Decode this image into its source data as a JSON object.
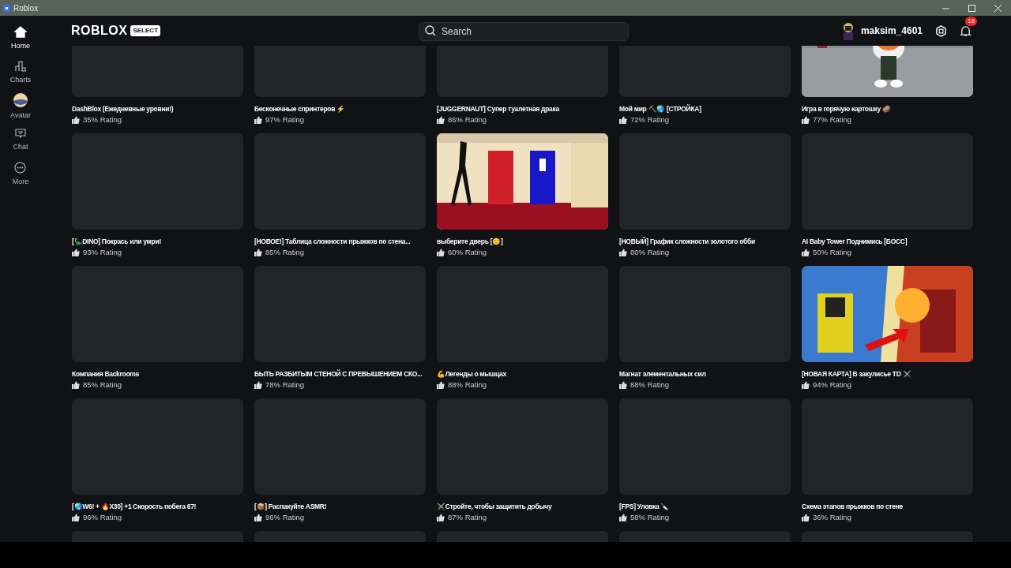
{
  "window": {
    "title": "Roblox"
  },
  "sidebar": {
    "items": [
      {
        "label": "Home",
        "selected": true
      },
      {
        "label": "Charts",
        "selected": false
      },
      {
        "label": "Avatar",
        "selected": false
      },
      {
        "label": "Chat",
        "selected": false
      },
      {
        "label": "More",
        "selected": false
      }
    ]
  },
  "header": {
    "logo": "ROBLOX",
    "logo_badge": "SELECT",
    "search": {
      "placeholder": "Search"
    },
    "username": "maksim_4601",
    "notification_count": "18"
  },
  "games": [
    {
      "title": "DashBlox (Ежедневные уровни!)",
      "rating": "35% Rating",
      "kind": "blank"
    },
    {
      "title": "Бесконечные спринтеров ⚡",
      "rating": "97% Rating",
      "kind": "blank"
    },
    {
      "title": "[JUGGERNAUT] Супер туалетная драка",
      "rating": "86% Rating",
      "kind": "blank"
    },
    {
      "title": "Мой мир ⛏️🌏 [СТРОЙКА]",
      "rating": "72% Rating",
      "kind": "blank"
    },
    {
      "title": "Игра в горячую картошку 🥔",
      "rating": "77% Rating",
      "kind": "picture"
    },
    {
      "title": "[🦕DINO] Покрась или умри!",
      "rating": "93% Rating",
      "kind": "blank"
    },
    {
      "title": "[НОВОЕ!] Таблица сложности прыжков по стена...",
      "rating": "85% Rating",
      "kind": "blank"
    },
    {
      "title": "выберите дверь [🙂]",
      "rating": "60% Rating",
      "kind": "picture"
    },
    {
      "title": "[НОВЫЙ] График сложности золотого обби",
      "rating": "80% Rating",
      "kind": "blank"
    },
    {
      "title": "AI Baby Tower Поднимись [БОСС]",
      "rating": "50% Rating",
      "kind": "blank"
    },
    {
      "title": "Компания Backrooms",
      "rating": "85% Rating",
      "kind": "blank"
    },
    {
      "title": "БЫТЬ РАЗБИТЫМ СТЕНОЙ С ПРЕВЫШЕНИЕМ СКО...",
      "rating": "78% Rating",
      "kind": "blank"
    },
    {
      "title": "💪Легенды о мышцах",
      "rating": "88% Rating",
      "kind": "blank"
    },
    {
      "title": "Магнат элементальных сил",
      "rating": "88% Rating",
      "kind": "blank"
    },
    {
      "title": "[НОВАЯ КАРТА] В закулисье TD ⚔️",
      "rating": "94% Rating",
      "kind": "picture"
    },
    {
      "title": "[🌏W6! + 🔥X30] +1 Скорость побега 67!",
      "rating": "96% Rating",
      "kind": "blank"
    },
    {
      "title": "[📦] Распакуйте ASMR!",
      "rating": "96% Rating",
      "kind": "blank"
    },
    {
      "title": "⚔️Стройте, чтобы защитить добычу",
      "rating": "87% Rating",
      "kind": "blank"
    },
    {
      "title": "[FPS] Уловка 🔪",
      "rating": "58% Rating",
      "kind": "blank"
    },
    {
      "title": "Схема этапов прыжков по стене",
      "rating": "36% Rating",
      "kind": "blank"
    },
    {
      "kind": "blank"
    },
    {
      "kind": "blank"
    },
    {
      "kind": "blank"
    },
    {
      "kind": "blank"
    },
    {
      "kind": "blank"
    }
  ]
}
